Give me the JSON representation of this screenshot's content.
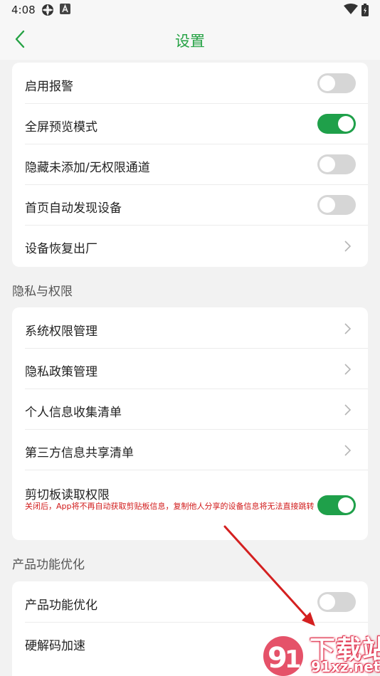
{
  "status_bar": {
    "time": "4:08",
    "icons": [
      "app-notification-icon",
      "a-badge-icon",
      "wifi-icon",
      "battery-icon"
    ]
  },
  "header": {
    "title": "设置",
    "back_icon": "chevron-left-icon"
  },
  "settings_card_1": {
    "rows": [
      {
        "label": "启用报警",
        "control": "toggle",
        "on": false
      },
      {
        "label": "全屏预览模式",
        "control": "toggle",
        "on": true
      },
      {
        "label": "隐藏未添加/无权限通道",
        "control": "toggle",
        "on": false
      },
      {
        "label": "首页自动发现设备",
        "control": "toggle",
        "on": false
      },
      {
        "label": "设备恢复出厂",
        "control": "chevron"
      }
    ]
  },
  "privacy_section": {
    "title": "隐私与权限",
    "rows": [
      {
        "label": "系统权限管理",
        "control": "chevron"
      },
      {
        "label": "隐私政策管理",
        "control": "chevron"
      },
      {
        "label": "个人信息收集清单",
        "control": "chevron"
      },
      {
        "label": "第三方信息共享清单",
        "control": "chevron"
      },
      {
        "label": "剪切板读取权限",
        "control": "toggle",
        "on": true,
        "note": "关闭后，App将不再自动获取剪贴板信息，复制他人分享的设备信息将无法直接跳转"
      }
    ]
  },
  "product_section": {
    "title": "产品功能优化",
    "rows": [
      {
        "label": "产品功能优化",
        "control": "toggle",
        "on": false
      },
      {
        "label": "硬解码加速"
      }
    ]
  },
  "watermark": {
    "title": "下载站",
    "url": "91xz.net"
  },
  "colors": {
    "accent_green": "#25a244",
    "toggle_on": "#1fa04a",
    "toggle_off": "#d6d6d6",
    "note_red": "#d11a1a",
    "arrow_red": "#d42020"
  }
}
